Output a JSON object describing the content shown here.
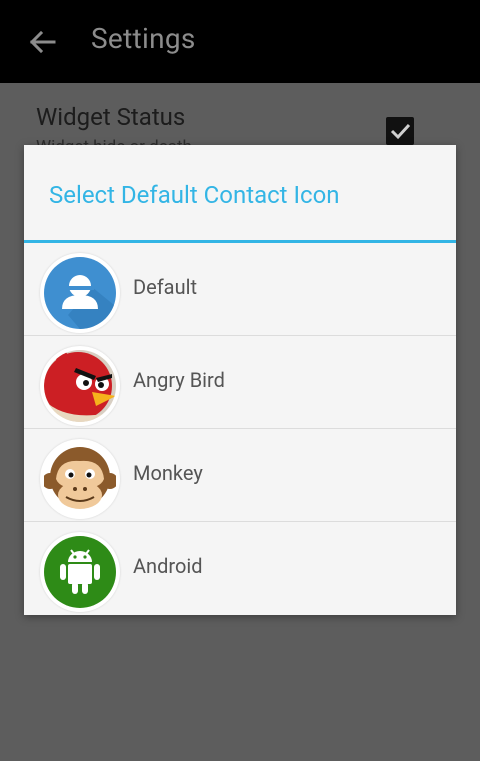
{
  "appbar": {
    "title": "Settings",
    "back_icon": "arrow-back-icon"
  },
  "preference": {
    "title": "Widget Status",
    "subtitle": "Widget hide or death",
    "checked": true
  },
  "dialog": {
    "title": "Select Default Contact Icon",
    "accent_color": "#33b5e5",
    "items": [
      {
        "label": "Default",
        "icon": "default-person-icon"
      },
      {
        "label": "Angry Bird",
        "icon": "angry-bird-icon"
      },
      {
        "label": "Monkey",
        "icon": "monkey-icon"
      },
      {
        "label": "Android",
        "icon": "android-icon"
      }
    ]
  }
}
